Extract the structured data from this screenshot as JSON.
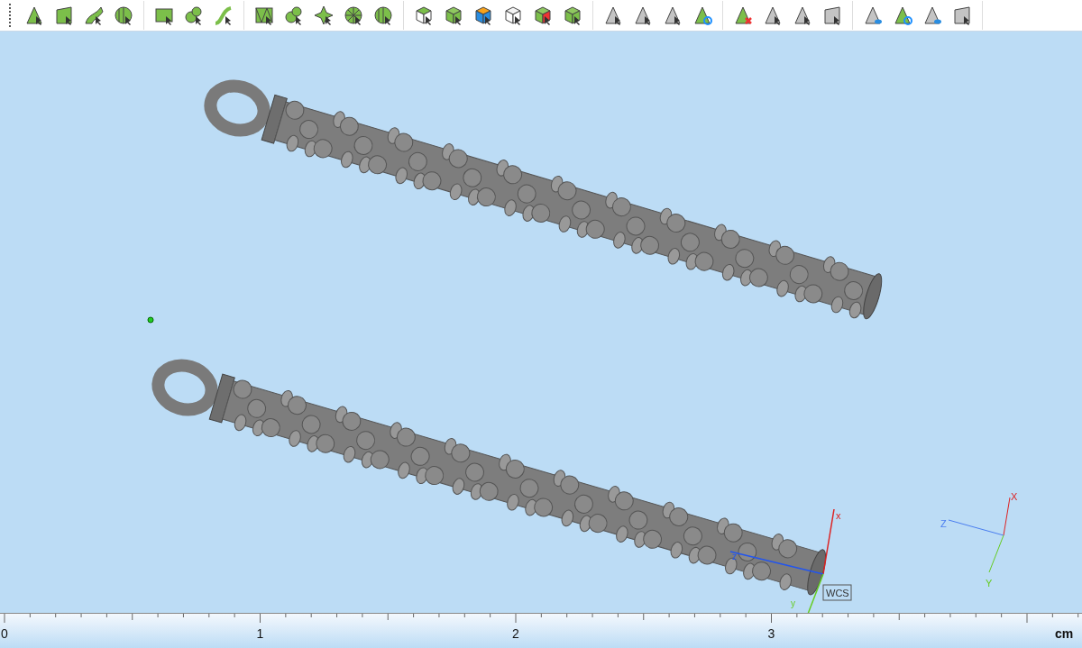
{
  "toolbar": {
    "groups": [
      {
        "buttons": [
          {
            "kind": "triangle"
          },
          {
            "kind": "quad"
          },
          {
            "kind": "sweep"
          },
          {
            "kind": "sphere"
          }
        ]
      },
      {
        "buttons": [
          {
            "kind": "rect"
          },
          {
            "kind": "blob"
          },
          {
            "kind": "curve"
          }
        ]
      },
      {
        "buttons": [
          {
            "kind": "mesh"
          },
          {
            "kind": "blob"
          },
          {
            "kind": "star"
          },
          {
            "kind": "wheel"
          },
          {
            "kind": "sphere"
          }
        ]
      },
      {
        "buttons": [
          {
            "kind": "cube"
          },
          {
            "kind": "cube-green"
          },
          {
            "kind": "cube-orange"
          },
          {
            "kind": "cube-ghost"
          },
          {
            "kind": "cube-red"
          },
          {
            "kind": "cube-arrow"
          }
        ]
      },
      {
        "buttons": [
          {
            "kind": "triangle-grey"
          },
          {
            "kind": "triangle-grey"
          },
          {
            "kind": "triangle-grey"
          },
          {
            "kind": "triangle-cycle"
          }
        ]
      },
      {
        "buttons": [
          {
            "kind": "triangle-delete"
          },
          {
            "kind": "triangle-grey"
          },
          {
            "kind": "triangle-grey"
          },
          {
            "kind": "quad-grey"
          }
        ]
      },
      {
        "buttons": [
          {
            "kind": "triangle-eye"
          },
          {
            "kind": "triangle-cycle"
          },
          {
            "kind": "triangle-eye"
          },
          {
            "kind": "quad-grey"
          }
        ]
      }
    ]
  },
  "viewport": {
    "wcs": {
      "label": "WCS",
      "x": "x",
      "y": "y",
      "z": "z"
    },
    "triad": {
      "x": "X",
      "y": "Y",
      "z": "Z"
    }
  },
  "ruler": {
    "labels": [
      "0",
      "1",
      "2",
      "3"
    ],
    "unit": "cm"
  }
}
